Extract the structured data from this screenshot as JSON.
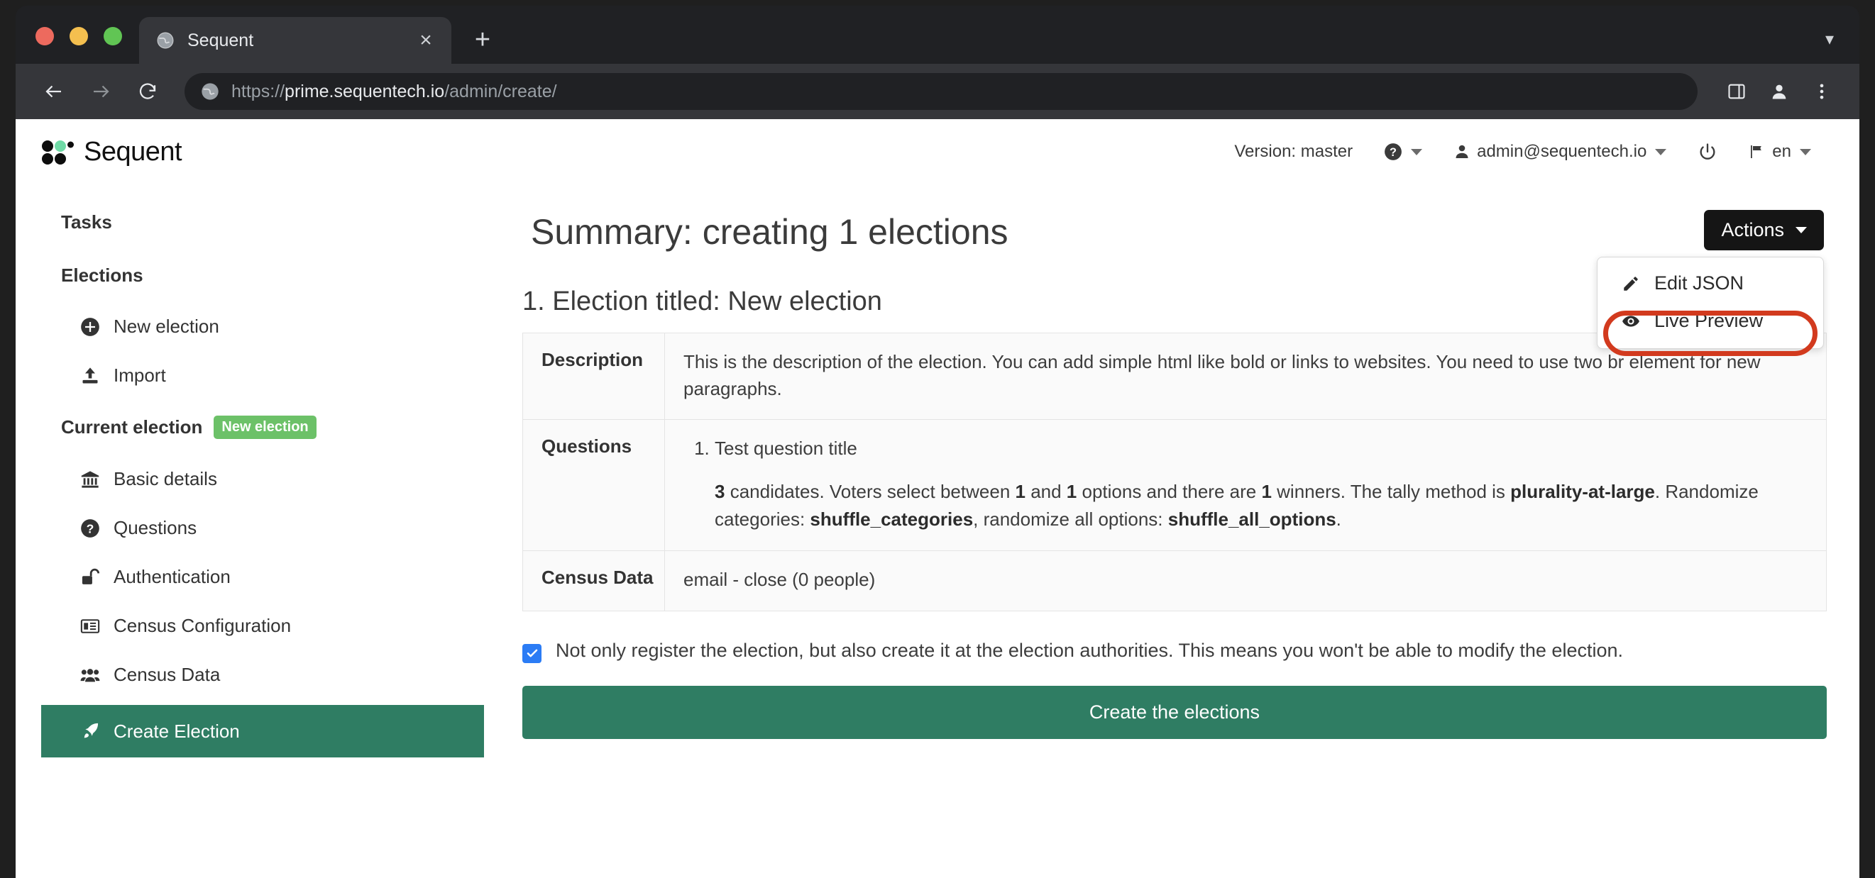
{
  "browser": {
    "tab": {
      "title": "Sequent",
      "favicon": "globe-icon",
      "close": "×"
    },
    "new_tab": "+",
    "window_list_caret": "▾",
    "url_scheme": "https://",
    "url_host": "prime.sequentech.io",
    "url_path": "/admin/create/"
  },
  "header": {
    "brand": "Sequent",
    "version": "Version: master",
    "user": "admin@sequentech.io",
    "language": "en"
  },
  "sidebar": {
    "tasks_label": "Tasks",
    "elections_label": "Elections",
    "elections_items": [
      {
        "label": "New election",
        "icon": "plus-circle-icon"
      },
      {
        "label": "Import",
        "icon": "upload-icon"
      }
    ],
    "current_election_label": "Current election",
    "current_election_badge": "New election",
    "current_items": [
      {
        "label": "Basic details",
        "icon": "bank-icon"
      },
      {
        "label": "Questions",
        "icon": "question-circle-icon"
      },
      {
        "label": "Authentication",
        "icon": "unlock-icon"
      },
      {
        "label": "Census Configuration",
        "icon": "id-card-icon"
      },
      {
        "label": "Census Data",
        "icon": "users-icon"
      }
    ],
    "active_item": {
      "label": "Create Election",
      "icon": "rocket-icon"
    }
  },
  "main": {
    "page_title": "Summary: creating 1 elections",
    "actions_button": "Actions",
    "dropdown": [
      {
        "label": "Edit JSON",
        "icon": "pencil-icon"
      },
      {
        "label": "Live Preview",
        "icon": "eye-icon"
      }
    ],
    "highlight_color": "#d23a1e",
    "section_title": "1. Election titled: New election",
    "table": {
      "description_label": "Description",
      "description_value": "This is the description of the election. You can add simple html like bold or links to websites. You need to use two br element for new paragraphs.",
      "questions_label": "Questions",
      "question_title": "Test question title",
      "q_candidates": "3",
      "q_min": "1",
      "q_max": "1",
      "q_winners": "1",
      "q_tally": "plurality-at-large",
      "q_randomize_categories": "shuffle_categories",
      "q_randomize_options": "shuffle_all_options",
      "q_text_1": " candidates. Voters select between ",
      "q_text_2": " and ",
      "q_text_3": " options and there are ",
      "q_text_4": " winners. The tally method is ",
      "q_text_5": ". Randomize categories: ",
      "q_text_6": ", randomize all options: ",
      "q_text_7": ".",
      "census_label": "Census Data",
      "census_value": "email - close (0 people)"
    },
    "checkbox_label": "Not only register the election, but also create it at the election authorities. This means you won't be able to modify the election.",
    "checkbox_checked": true,
    "create_button": "Create the elections"
  },
  "colors": {
    "brand_green": "#2f7d63",
    "badge_green": "#6cc168",
    "logo_accent": "#6fdaa6",
    "checkbox_blue": "#2b7cf5",
    "annotation_red": "#d23a1e"
  }
}
